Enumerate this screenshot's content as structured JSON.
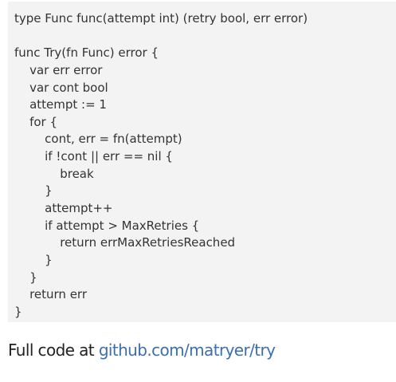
{
  "code": {
    "lines": [
      "type Func func(attempt int) (retry bool, err error)",
      "",
      "func Try(fn Func) error {",
      "    var err error",
      "    var cont bool",
      "    attempt := 1",
      "    for {",
      "        cont, err = fn(attempt)",
      "        if !cont || err == nil {",
      "            break",
      "        }",
      "        attempt++",
      "        if attempt > MaxRetries {",
      "            return errMaxRetriesReached",
      "        }",
      "    }",
      "    return err",
      "}"
    ]
  },
  "caption": {
    "prefix": "Full code at ",
    "link_text": "github.com/matryer/try"
  },
  "colors": {
    "code_background": "#f3f3f3",
    "code_text": "#333333",
    "link": "#3a6fb0"
  }
}
